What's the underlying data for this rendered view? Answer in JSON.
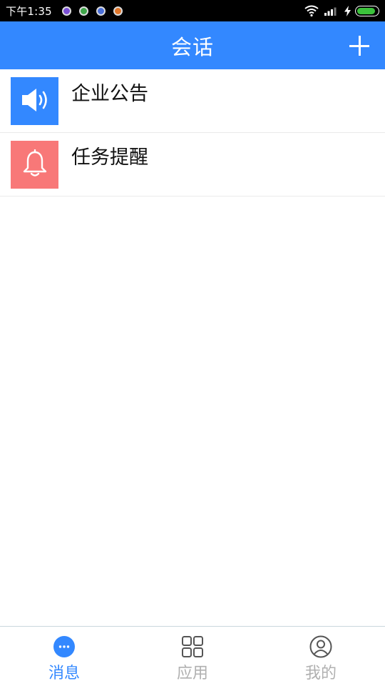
{
  "status_bar": {
    "time": "下午1:35",
    "notification_icons": [
      {
        "name": "app-notification-icon-1",
        "color": "#7b4fd6"
      },
      {
        "name": "app-notification-icon-2",
        "color": "#3fa64a"
      },
      {
        "name": "app-notification-icon-3",
        "color": "#4b6fd8"
      },
      {
        "name": "app-notification-icon-4",
        "color": "#e0762a"
      }
    ],
    "battery_level": 0.9
  },
  "header": {
    "title": "会话",
    "add_icon": "plus-icon",
    "background": "#3388ff"
  },
  "conversations": [
    {
      "title": "企业公告",
      "icon": "speaker-icon",
      "icon_bg": "#3388ff"
    },
    {
      "title": "任务提醒",
      "icon": "bell-icon",
      "icon_bg": "#f87878"
    }
  ],
  "tab_bar": {
    "tabs": [
      {
        "label": "消息",
        "icon": "chat-bubble-icon",
        "active": true
      },
      {
        "label": "应用",
        "icon": "apps-grid-icon",
        "active": false
      },
      {
        "label": "我的",
        "icon": "profile-icon",
        "active": false
      }
    ],
    "active_color": "#3388ff",
    "inactive_color": "#b0b0b0"
  }
}
